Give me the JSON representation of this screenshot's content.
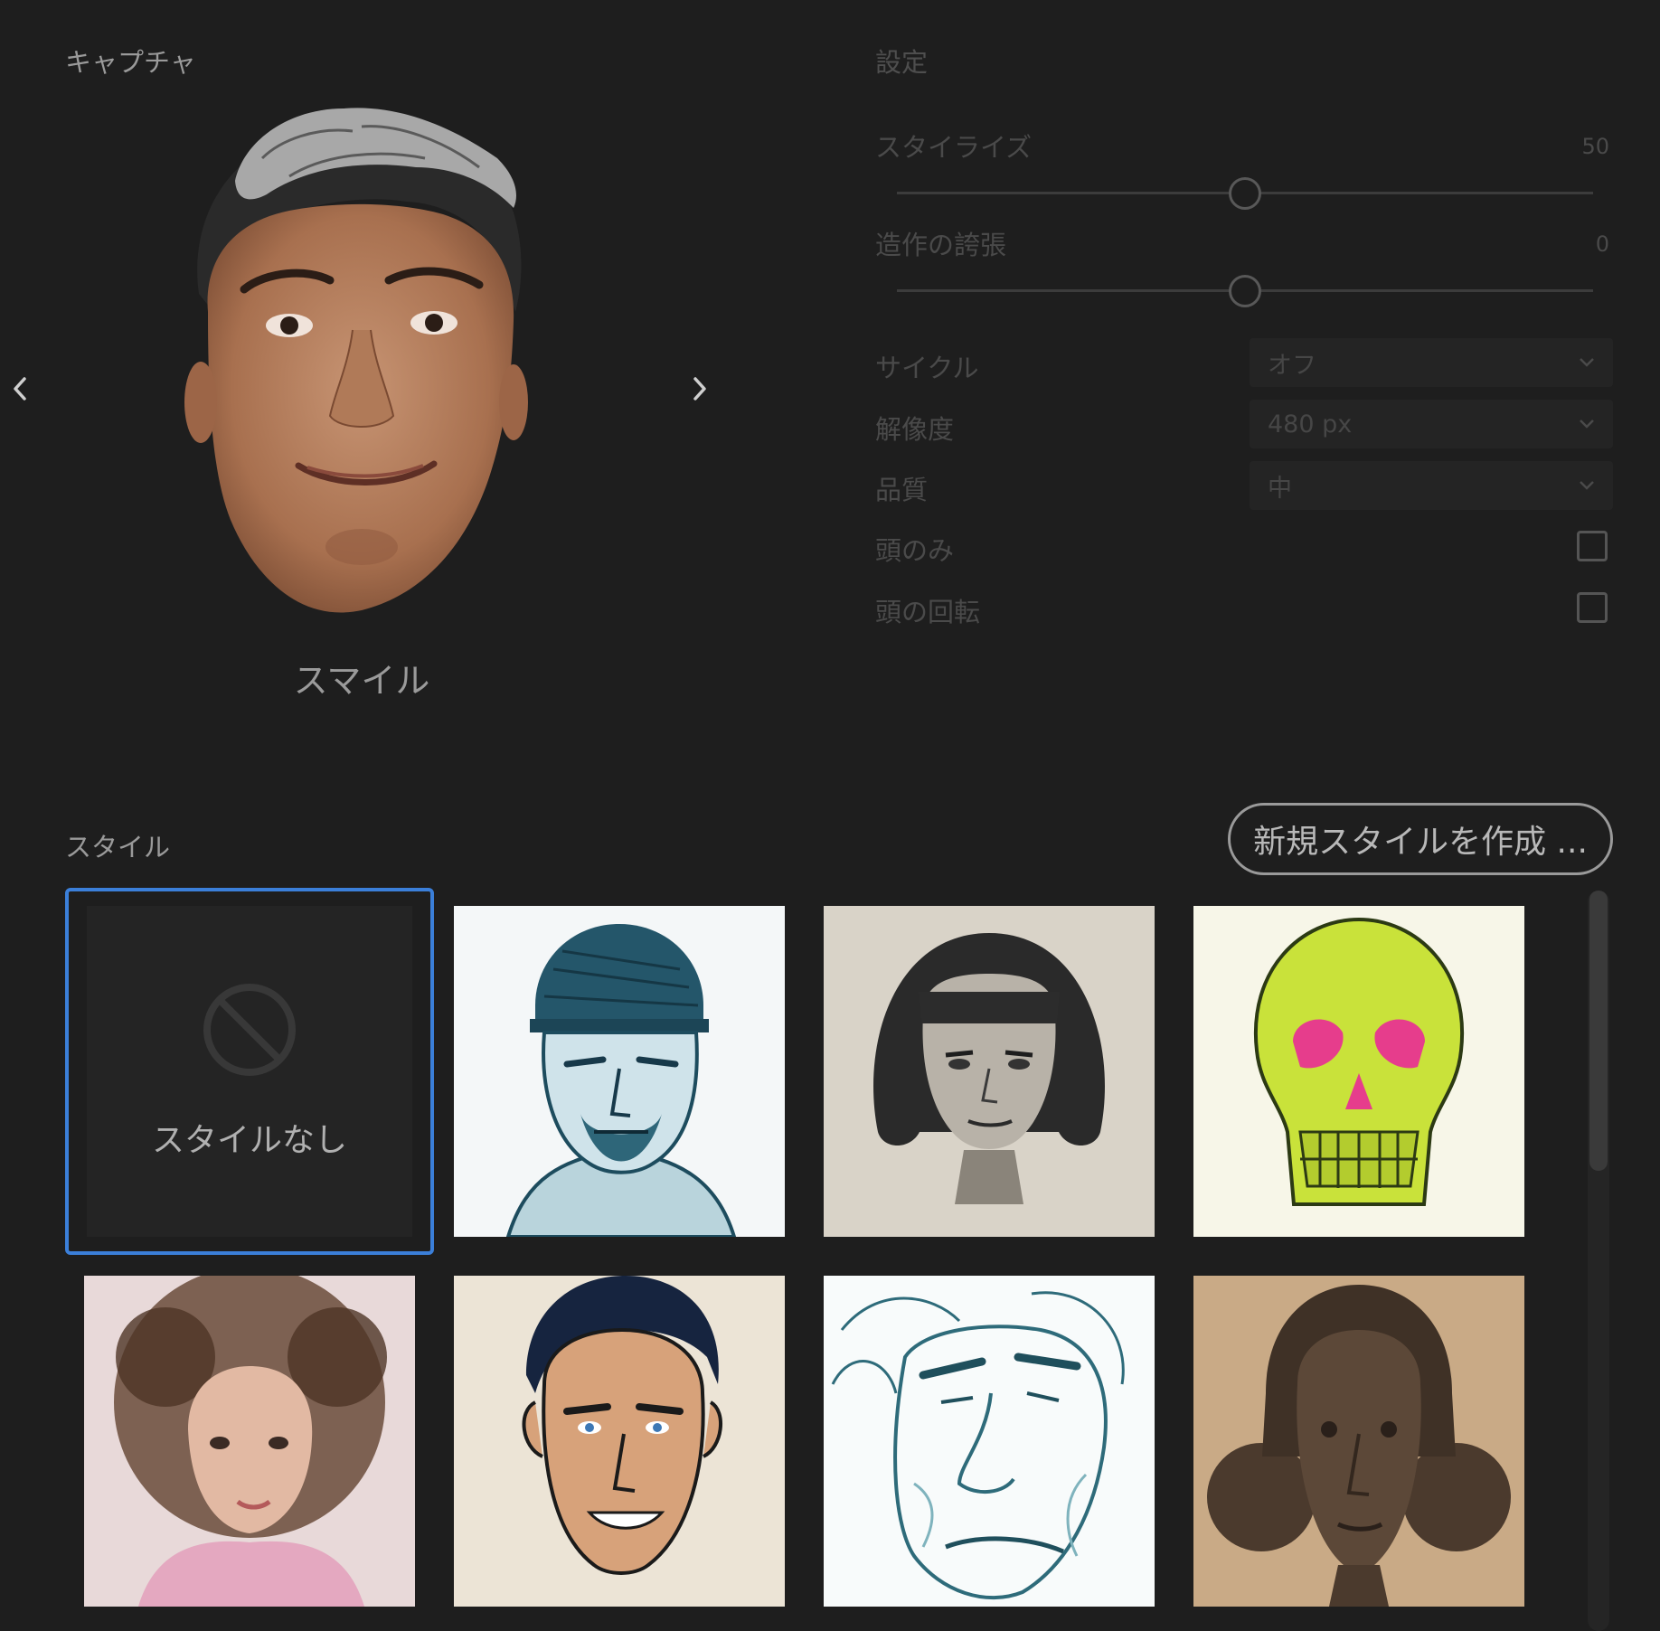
{
  "capture": {
    "title": "キャプチャ",
    "expression_label": "スマイル"
  },
  "settings": {
    "title": "設定",
    "stylize": {
      "label": "スタイライズ",
      "value": "50",
      "level": 0.5
    },
    "exaggeration": {
      "label": "造作の誇張",
      "value": "0",
      "level": 0.5
    },
    "cycle": {
      "label": "サイクル",
      "value": "オフ"
    },
    "resolution": {
      "label": "解像度",
      "value": "480 px"
    },
    "quality": {
      "label": "品質",
      "value": "中"
    },
    "head_only": {
      "label": "頭のみ",
      "checked": false
    },
    "head_rotation": {
      "label": "頭の回転",
      "checked": false
    }
  },
  "styles": {
    "title": "スタイル",
    "new_button": "新規スタイルを作成 ...",
    "no_style_label": "スタイルなし"
  },
  "colors": {
    "background": "#1e1e1e",
    "selection_accent": "#3b7fd9"
  }
}
